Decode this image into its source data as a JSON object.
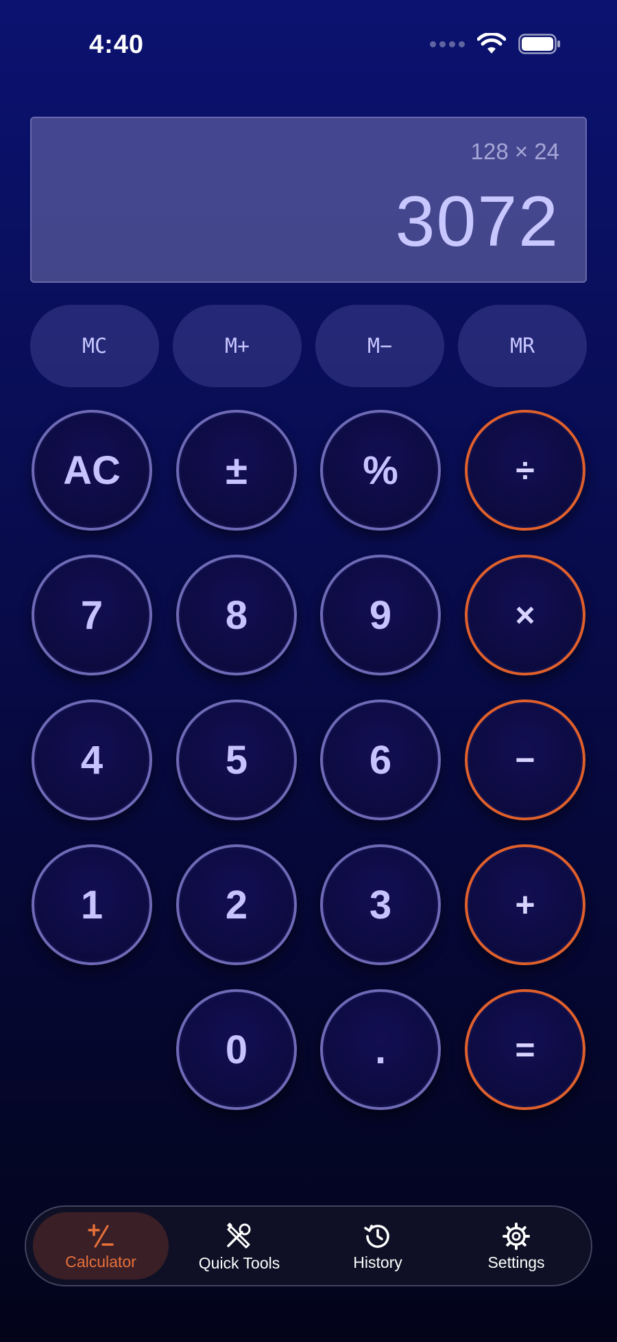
{
  "status_bar": {
    "time": "4:40"
  },
  "display": {
    "expression": "128 × 24",
    "result": "3072"
  },
  "memory": [
    {
      "label": "MC",
      "name": "memory-clear-button"
    },
    {
      "label": "M+",
      "name": "memory-add-button"
    },
    {
      "label": "M−",
      "name": "memory-subtract-button"
    },
    {
      "label": "MR",
      "name": "memory-recall-button"
    }
  ],
  "keys": {
    "ac": "AC",
    "plus_minus": "±",
    "percent": "%",
    "divide": "÷",
    "seven": "7",
    "eight": "8",
    "nine": "9",
    "multiply": "×",
    "four": "4",
    "five": "5",
    "six": "6",
    "minus": "−",
    "one": "1",
    "two": "2",
    "three": "3",
    "plus": "+",
    "zero": "0",
    "decimal": ".",
    "equals": "="
  },
  "tabs": [
    {
      "label": "Calculator",
      "icon": "plus-minus-icon",
      "active": true
    },
    {
      "label": "Quick Tools",
      "icon": "tools-icon",
      "active": false
    },
    {
      "label": "History",
      "icon": "history-icon",
      "active": false
    },
    {
      "label": "Settings",
      "icon": "gear-icon",
      "active": false
    }
  ],
  "colors": {
    "accent": "#e0602c",
    "key_border": "#6e6ab6",
    "display_text": "#c9c7ff",
    "background_top": "#0b1270",
    "background_bottom": "#03041a"
  }
}
